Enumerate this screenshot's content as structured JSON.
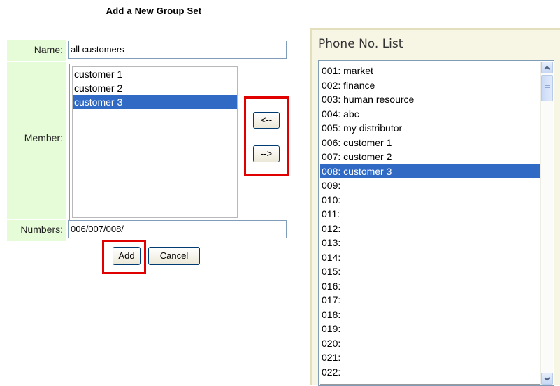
{
  "form": {
    "title": "Add a New Group Set",
    "name_label": "Name:",
    "name_value": "all customers",
    "member_label": "Member:",
    "members": [
      "customer 1",
      "customer 2",
      "customer 3"
    ],
    "selected_member": "customer 3",
    "numbers_label": "Numbers:",
    "numbers_value": "006/007/008/",
    "move_left_label": "<--",
    "move_right_label": "-->",
    "add_label": "Add",
    "cancel_label": "Cancel"
  },
  "phone_list": {
    "title": "Phone No. List",
    "items": [
      "001: market",
      "002: finance",
      "003: human resource",
      "004: abc",
      "005: my distributor",
      "006: customer 1",
      "007: customer 2",
      "008: customer 3",
      "009:",
      "010:",
      "011:",
      "012:",
      "013:",
      "014:",
      "015:",
      "016:",
      "017:",
      "018:",
      "019:",
      "020:",
      "021:",
      "022:"
    ],
    "selected_item": "008: customer 3"
  },
  "icons": {
    "scroll_up": "chevron-up-icon",
    "scroll_down": "chevron-down-icon"
  },
  "colors": {
    "label_bg": "#e6fbd8",
    "selection": "#316ac5",
    "highlight_box": "#e00000",
    "panel_bg": "#f7f5e3"
  }
}
